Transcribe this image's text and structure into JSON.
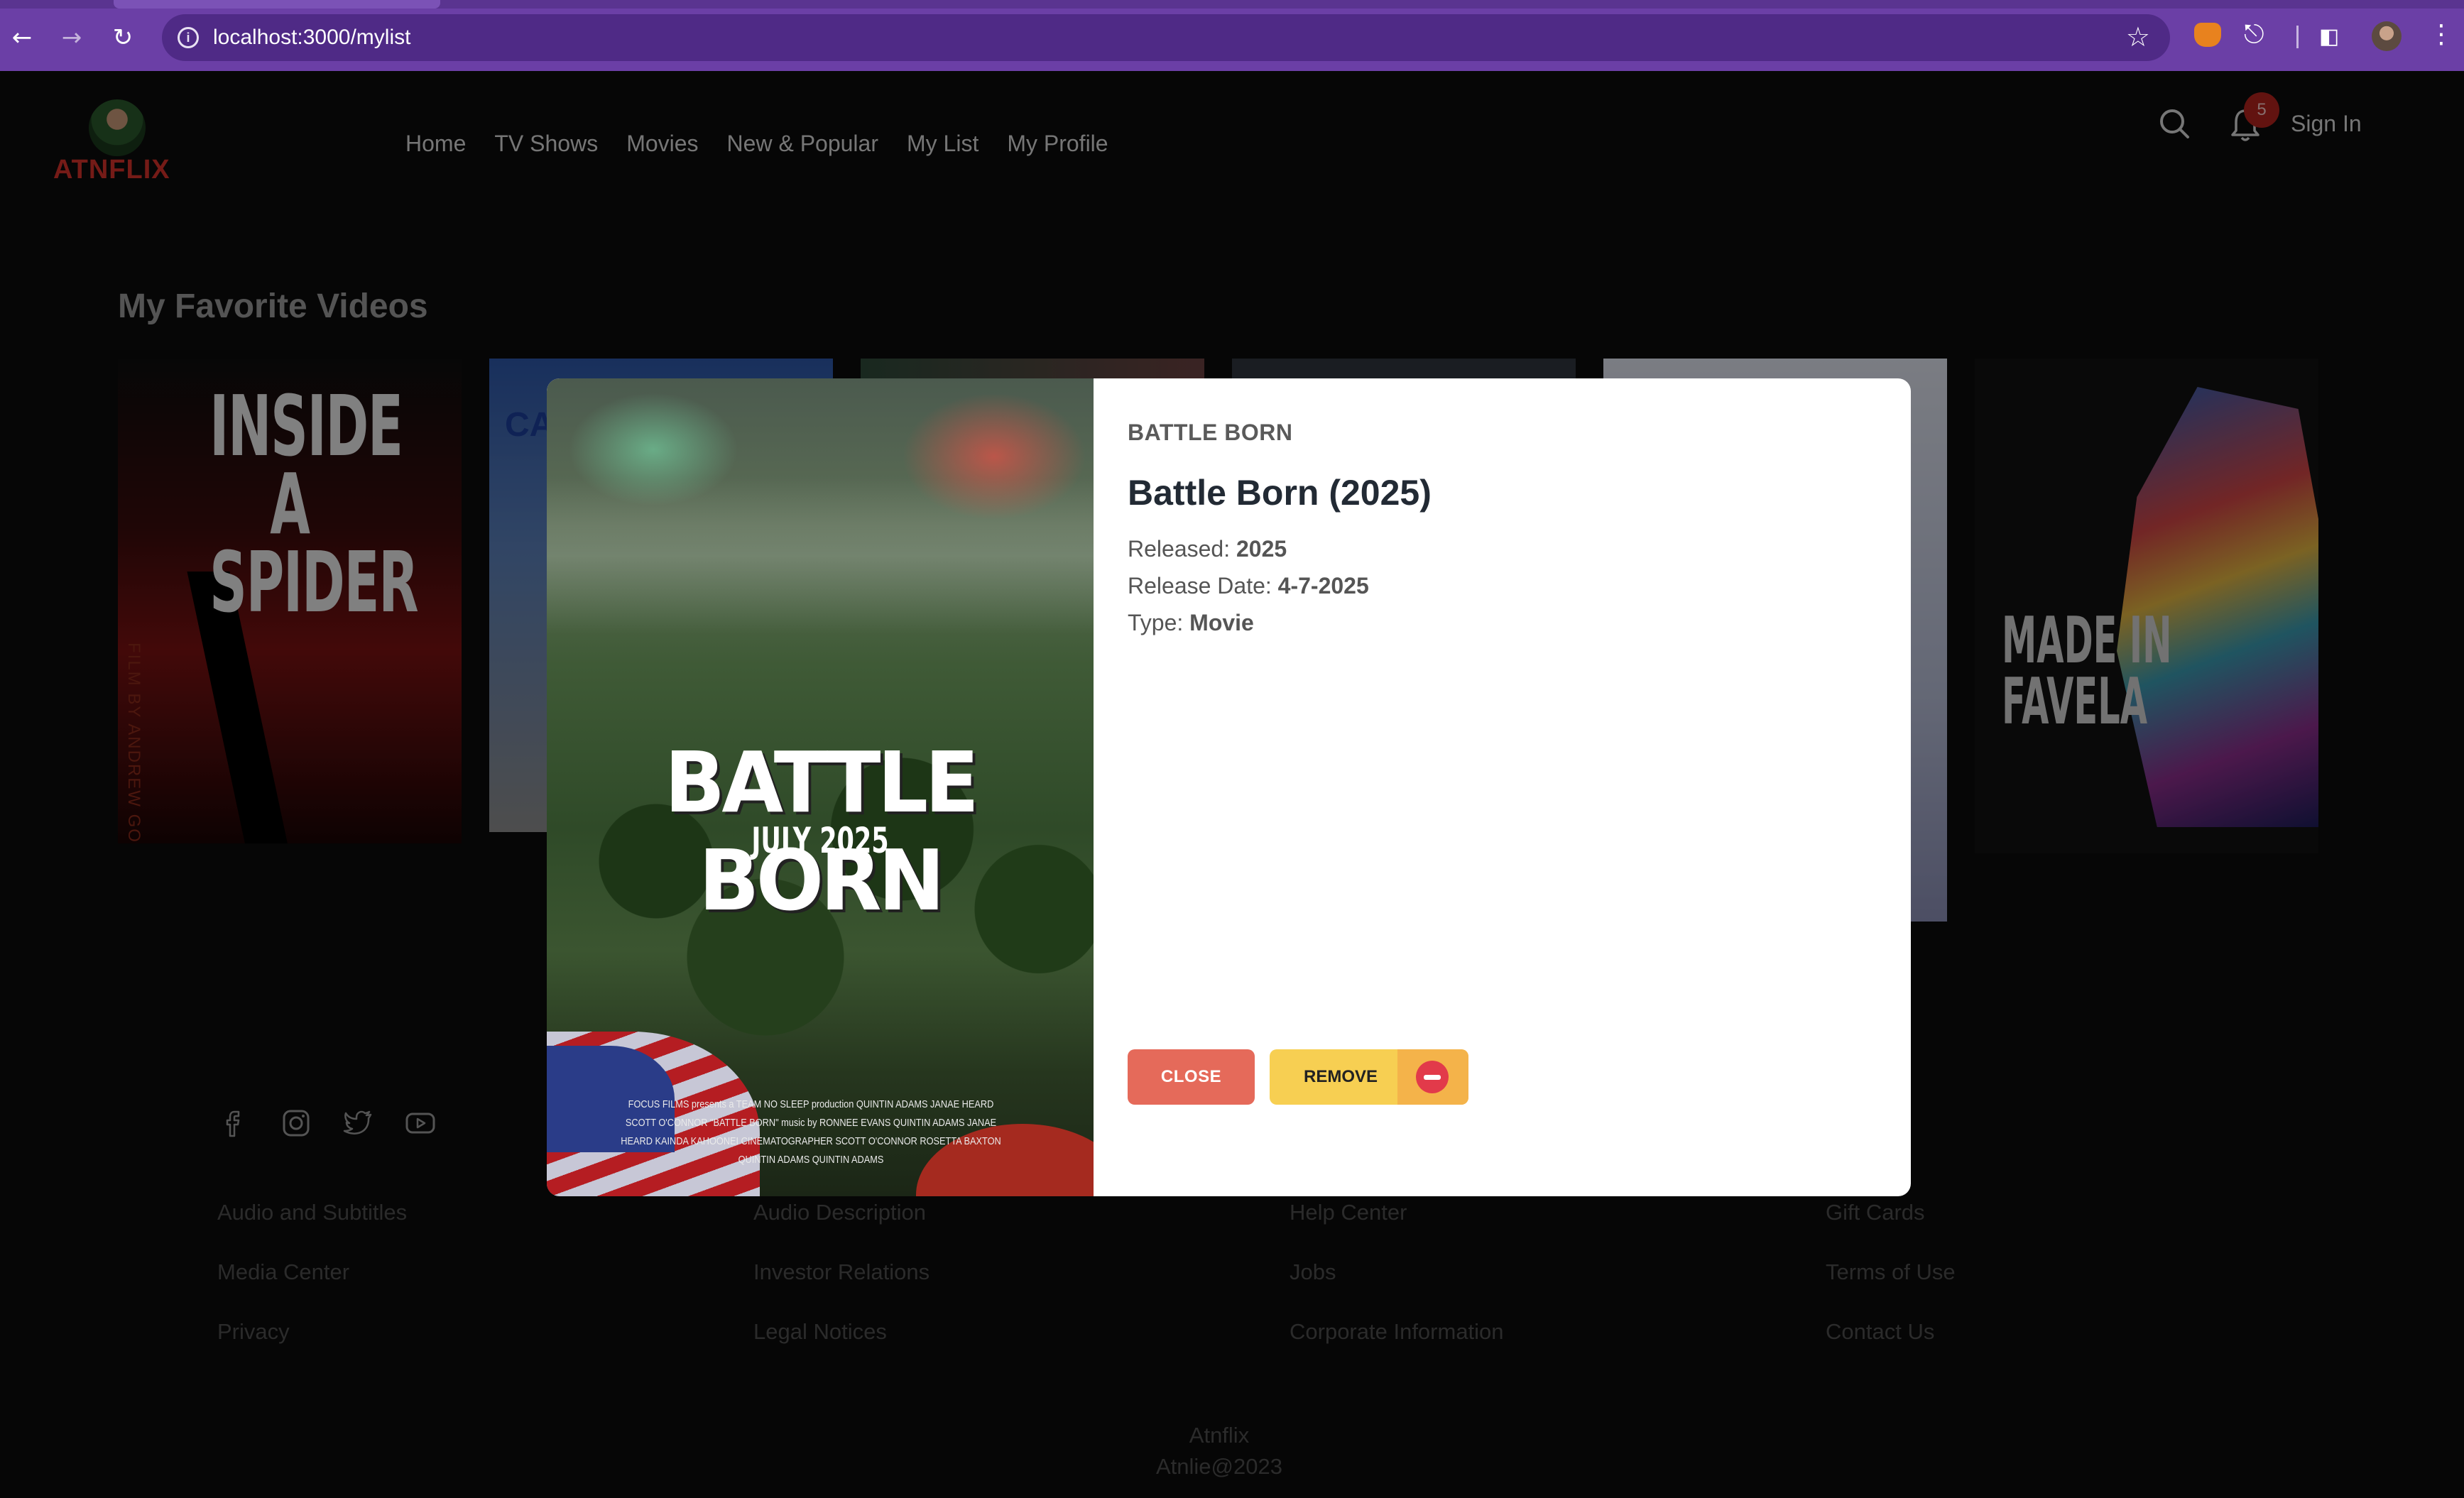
{
  "browser": {
    "url": "localhost:3000/mylist",
    "back_icon": "arrow-left-icon",
    "forward_icon": "arrow-right-icon",
    "reload_icon": "reload-icon"
  },
  "site": {
    "logo_text": "ATNFLIX",
    "nav": [
      "Home",
      "TV Shows",
      "Movies",
      "New & Popular",
      "My List",
      "My Profile"
    ],
    "notification_count": "5",
    "sign_in": "Sign In"
  },
  "page": {
    "section_title": "My Favorite Videos"
  },
  "posters": [
    {
      "title_text": "INSIDE A SPIDER",
      "side_text": "FILM BY ANDREW GONZALEZ"
    },
    {
      "title_text": "CA"
    },
    {
      "title_text": ""
    },
    {
      "title_text": ""
    },
    {
      "title_text": ""
    },
    {
      "title_text": "MADE IN FAVELA"
    }
  ],
  "modal": {
    "poster_title": "BATTLE BORN",
    "poster_date": "JULY 2025",
    "poster_credits": "FOCUS FILMS presents a TEAM NO SLEEP production QUINTIN ADAMS JANAE HEARD SCOTT O'CONNOR \"BATTLE BORN\" music by RONNEE EVANS QUINTIN ADAMS JANAE HEARD KAINDA KAHOONEI CINEMATOGRAPHER SCOTT O'CONNOR ROSETTA BAXTON QUINTIN ADAMS QUINTIN ADAMS",
    "eyebrow": "BATTLE BORN",
    "title": "Battle Born (2025)",
    "released_label": "Released: ",
    "released_value": "2025",
    "release_date_label": "Release Date: ",
    "release_date_value": "4-7-2025",
    "type_label": "Type: ",
    "type_value": "Movie",
    "close_label": "CLOSE",
    "remove_label": "REMOVE"
  },
  "footer": {
    "socials": [
      "facebook-icon",
      "instagram-icon",
      "twitter-icon",
      "youtube-icon"
    ],
    "col1": [
      "Audio and Subtitles",
      "Media Center",
      "Privacy"
    ],
    "col2": [
      "Audio Description",
      "Investor Relations",
      "Legal Notices"
    ],
    "col3": [
      "Help Center",
      "Jobs",
      "Corporate Information"
    ],
    "col4": [
      "Gift Cards",
      "Terms of Use",
      "Contact Us"
    ],
    "brand": "Atnflix",
    "copyright": "Atnlie@2023"
  },
  "colors": {
    "browser_accent": "#6b3fa6",
    "logo_red": "#d5322b",
    "close_button": "#e56a5a",
    "remove_button": "#f7cf52"
  }
}
